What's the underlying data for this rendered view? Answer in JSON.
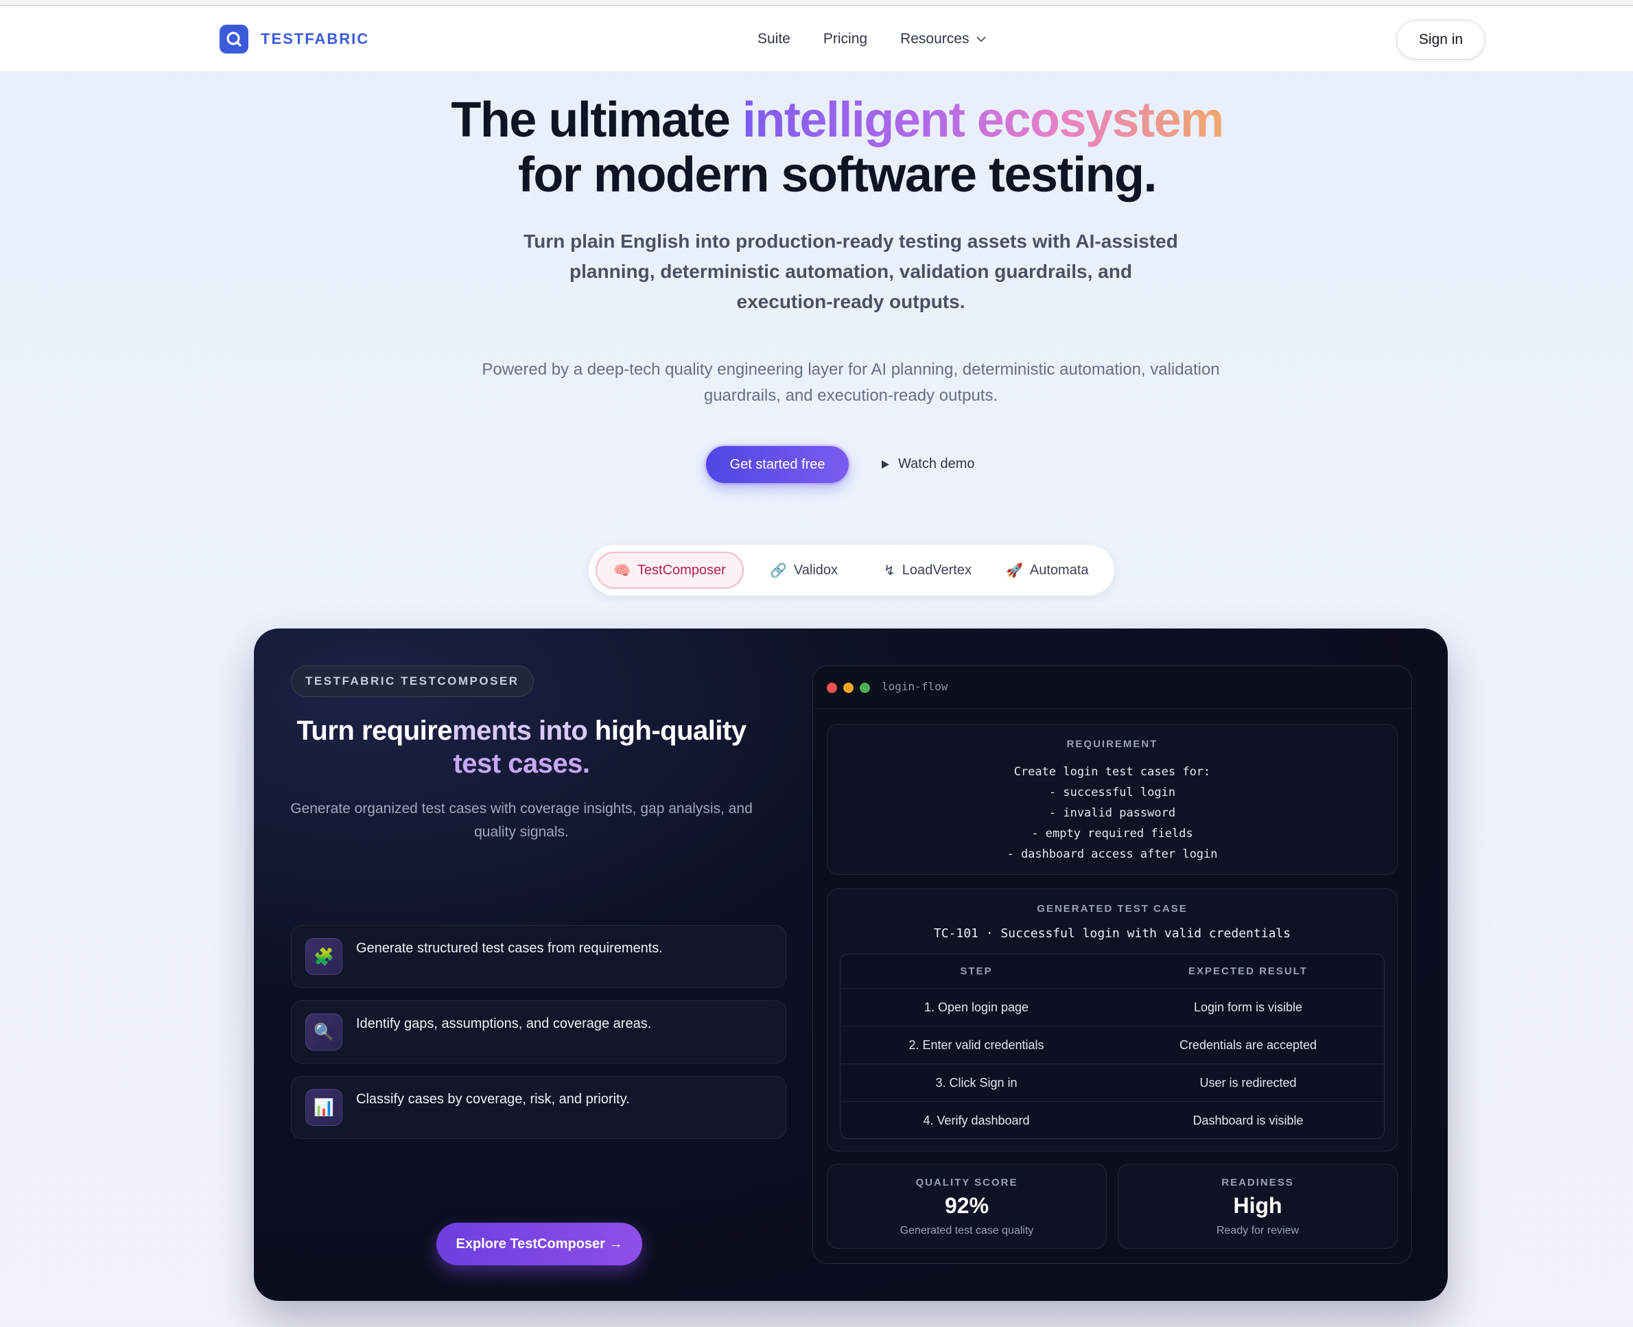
{
  "brand": {
    "name": "TESTFABRIC"
  },
  "nav": {
    "links": [
      "Suite",
      "Pricing",
      "Resources"
    ],
    "signin_label": "Sign in"
  },
  "hero": {
    "title_part1": "The ultimate ",
    "title_highlight": "intelligent ecosystem",
    "title_part2": "for modern software testing.",
    "subtitle": "Turn plain English into production-ready testing assets with AI-assisted planning, deterministic automation, validation guardrails, and execution-ready outputs.",
    "description": "Powered by a deep-tech quality engineering layer for AI planning, deterministic automation, validation guardrails, and execution-ready outputs.",
    "cta_primary": "Get started free",
    "cta_secondary": "Watch demo"
  },
  "tabs": [
    {
      "icon": "🧠",
      "label": "TestComposer"
    },
    {
      "icon": "🔗",
      "label": "Validox"
    },
    {
      "icon": "↯",
      "label": "LoadVertex"
    },
    {
      "icon": "🚀",
      "label": "Automata"
    }
  ],
  "panel": {
    "badge": "TESTFABRIC TESTCOMPOSER",
    "title_a": "Turn require",
    "title_b": "ments into",
    "title_c": " high-quality",
    "title_d": "test cases.",
    "description": "Generate organized test cases with coverage insights, gap analysis, and quality signals.",
    "features": [
      {
        "icon": "🧩",
        "text": "Generate structured test cases from requirements."
      },
      {
        "icon": "🔍",
        "text": "Identify gaps, assumptions, and coverage areas."
      },
      {
        "icon": "📊",
        "text": "Classify cases by coverage, risk, and priority."
      }
    ],
    "explore_label": "Explore TestComposer →"
  },
  "window": {
    "name": "login-flow",
    "requirement_label": "REQUIREMENT",
    "requirement_lines": [
      "Create login test cases for:",
      "- successful login",
      "- invalid password",
      "- empty required fields",
      "- dashboard access after login"
    ],
    "generated_label": "GENERATED TEST CASE",
    "testcase_title": "TC-101 · Successful login with valid credentials",
    "table": {
      "headers": [
        "STEP",
        "EXPECTED RESULT"
      ],
      "rows": [
        [
          "1. Open login page",
          "Login form is visible"
        ],
        [
          "2. Enter valid credentials",
          "Credentials are accepted"
        ],
        [
          "3. Click Sign in",
          "User is redirected"
        ],
        [
          "4. Verify dashboard",
          "Dashboard is visible"
        ]
      ]
    },
    "metrics": [
      {
        "label": "QUALITY SCORE",
        "value": "92%",
        "sub": "Generated test case quality"
      },
      {
        "label": "READINESS",
        "value": "High",
        "sub": "Ready for review"
      }
    ]
  },
  "colors": {
    "brand": "#3b5bdb",
    "accent_purple": "#7c5cf0",
    "active_tab": "#b0244c"
  }
}
